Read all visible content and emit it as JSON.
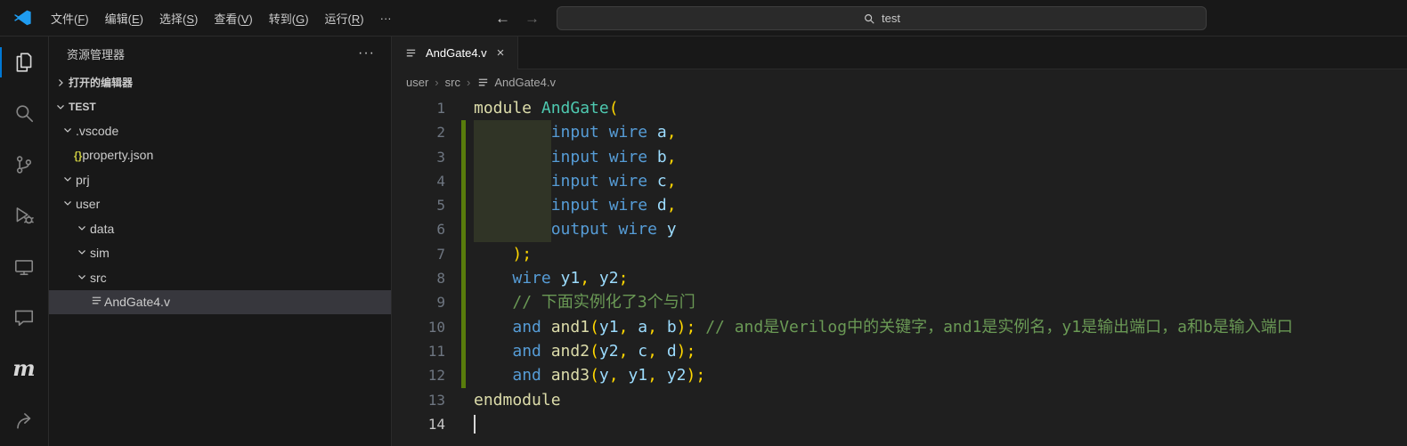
{
  "titlebar": {
    "menus": [
      {
        "label": "文件(F)"
      },
      {
        "label": "编辑(E)"
      },
      {
        "label": "选择(S)"
      },
      {
        "label": "查看(V)"
      },
      {
        "label": "转到(G)"
      },
      {
        "label": "运行(R)"
      },
      {
        "label": "···"
      }
    ],
    "nav": {
      "back": "←",
      "forward": "→",
      "back_enabled": true,
      "forward_enabled": false
    },
    "command_center": {
      "query": "test",
      "icon": "search-icon"
    }
  },
  "activity_bar": {
    "items": [
      {
        "name": "explorer",
        "icon": "explorer-icon",
        "active": true
      },
      {
        "name": "search",
        "icon": "search-icon",
        "active": false
      },
      {
        "name": "source-control",
        "icon": "source-control-icon",
        "active": false
      },
      {
        "name": "run-and-debug",
        "icon": "run-debug-icon",
        "active": false
      },
      {
        "name": "remote-explorer",
        "icon": "monitor-icon",
        "active": false
      },
      {
        "name": "comments",
        "icon": "comment-icon",
        "active": false
      },
      {
        "name": "model-tool",
        "icon": "m-logo-icon",
        "active": false
      },
      {
        "name": "share",
        "icon": "share-icon",
        "active": false
      }
    ]
  },
  "sidebar": {
    "title": "资源管理器",
    "more_actions": "···",
    "sections": {
      "open_editors": "打开的编辑器",
      "workspace": "TEST"
    },
    "tree": [
      {
        "label": ".vscode",
        "level": 1,
        "kind": "folder",
        "expanded": true,
        "selected": false
      },
      {
        "label": "property.json",
        "level": 2,
        "kind": "json",
        "selected": false
      },
      {
        "label": "prj",
        "level": 1,
        "kind": "folder",
        "expanded": true,
        "selected": false
      },
      {
        "label": "user",
        "level": 1,
        "kind": "folder",
        "expanded": true,
        "selected": false
      },
      {
        "label": "data",
        "level": 2,
        "kind": "folder",
        "expanded": true,
        "selected": false
      },
      {
        "label": "sim",
        "level": 2,
        "kind": "folder",
        "expanded": true,
        "selected": false
      },
      {
        "label": "src",
        "level": 2,
        "kind": "folder",
        "expanded": true,
        "selected": false
      },
      {
        "label": "AndGate4.v",
        "level": 3,
        "kind": "verilog",
        "selected": true
      }
    ]
  },
  "editor": {
    "tab": {
      "label": "AndGate4.v",
      "icon": "file-lines-icon",
      "close": "×"
    },
    "breadcrumb": {
      "items": [
        "user",
        "src",
        "AndGate4.v"
      ],
      "separator": "›"
    },
    "code": {
      "active_line": 14,
      "token_colors": {
        "kw": "#569CD6",
        "id": "#9CDCFE",
        "ty": "#4EC9B0",
        "fn": "#DCDCAA",
        "mo": "#DCDCAA",
        "pu": "#FFD700",
        "cm": "#6A9955",
        "pl": "#d4d4d4"
      },
      "lines": [
        {
          "num": 1,
          "tokens": [
            [
              "module ",
              "mo"
            ],
            [
              "AndGate",
              "ty"
            ],
            [
              "(",
              "pu"
            ]
          ]
        },
        {
          "num": 2,
          "tokens": [
            [
              "        ",
              "pl"
            ],
            [
              "input wire ",
              "kw"
            ],
            [
              "a",
              "id"
            ],
            [
              ",",
              "pu"
            ]
          ]
        },
        {
          "num": 3,
          "tokens": [
            [
              "        ",
              "pl"
            ],
            [
              "input wire ",
              "kw"
            ],
            [
              "b",
              "id"
            ],
            [
              ",",
              "pu"
            ]
          ]
        },
        {
          "num": 4,
          "tokens": [
            [
              "        ",
              "pl"
            ],
            [
              "input wire ",
              "kw"
            ],
            [
              "c",
              "id"
            ],
            [
              ",",
              "pu"
            ]
          ]
        },
        {
          "num": 5,
          "tokens": [
            [
              "        ",
              "pl"
            ],
            [
              "input wire ",
              "kw"
            ],
            [
              "d",
              "id"
            ],
            [
              ",",
              "pu"
            ]
          ]
        },
        {
          "num": 6,
          "tokens": [
            [
              "        ",
              "pl"
            ],
            [
              "output wire ",
              "kw"
            ],
            [
              "y",
              "id"
            ]
          ]
        },
        {
          "num": 7,
          "tokens": [
            [
              "    ",
              "pl"
            ],
            [
              ");",
              "pu"
            ]
          ]
        },
        {
          "num": 8,
          "tokens": [
            [
              "    ",
              "pl"
            ],
            [
              "wire ",
              "kw"
            ],
            [
              "y1",
              "id"
            ],
            [
              ", ",
              "pu"
            ],
            [
              "y2",
              "id"
            ],
            [
              ";",
              "pu"
            ]
          ]
        },
        {
          "num": 9,
          "tokens": [
            [
              "    ",
              "pl"
            ],
            [
              "// 下面实例化了3个与门",
              "cm"
            ]
          ]
        },
        {
          "num": 10,
          "tokens": [
            [
              "    ",
              "pl"
            ],
            [
              "and ",
              "kw"
            ],
            [
              "and1",
              "fn"
            ],
            [
              "(",
              "pu"
            ],
            [
              "y1",
              "id"
            ],
            [
              ", ",
              "pu"
            ],
            [
              "a",
              "id"
            ],
            [
              ", ",
              "pu"
            ],
            [
              "b",
              "id"
            ],
            [
              ");",
              "pu"
            ],
            [
              " ",
              "pl"
            ],
            [
              "// and是Verilog中的关键字，and1是实例名，y1是输出端口，a和b是输入端口",
              "cm"
            ]
          ]
        },
        {
          "num": 11,
          "tokens": [
            [
              "    ",
              "pl"
            ],
            [
              "and ",
              "kw"
            ],
            [
              "and2",
              "fn"
            ],
            [
              "(",
              "pu"
            ],
            [
              "y2",
              "id"
            ],
            [
              ", ",
              "pu"
            ],
            [
              "c",
              "id"
            ],
            [
              ", ",
              "pu"
            ],
            [
              "d",
              "id"
            ],
            [
              ");",
              "pu"
            ]
          ]
        },
        {
          "num": 12,
          "tokens": [
            [
              "    ",
              "pl"
            ],
            [
              "and ",
              "kw"
            ],
            [
              "and3",
              "fn"
            ],
            [
              "(",
              "pu"
            ],
            [
              "y",
              "id"
            ],
            [
              ", ",
              "pu"
            ],
            [
              "y1",
              "id"
            ],
            [
              ", ",
              "pu"
            ],
            [
              "y2",
              "id"
            ],
            [
              ");",
              "pu"
            ]
          ]
        },
        {
          "num": 13,
          "tokens": [
            [
              "endmodule",
              "mo"
            ]
          ]
        },
        {
          "num": 14,
          "tokens": []
        }
      ],
      "decorations": {
        "git_added": {
          "from": 2,
          "to": 12
        },
        "indent_highlight": {
          "from": 2,
          "to": 6
        }
      }
    }
  }
}
